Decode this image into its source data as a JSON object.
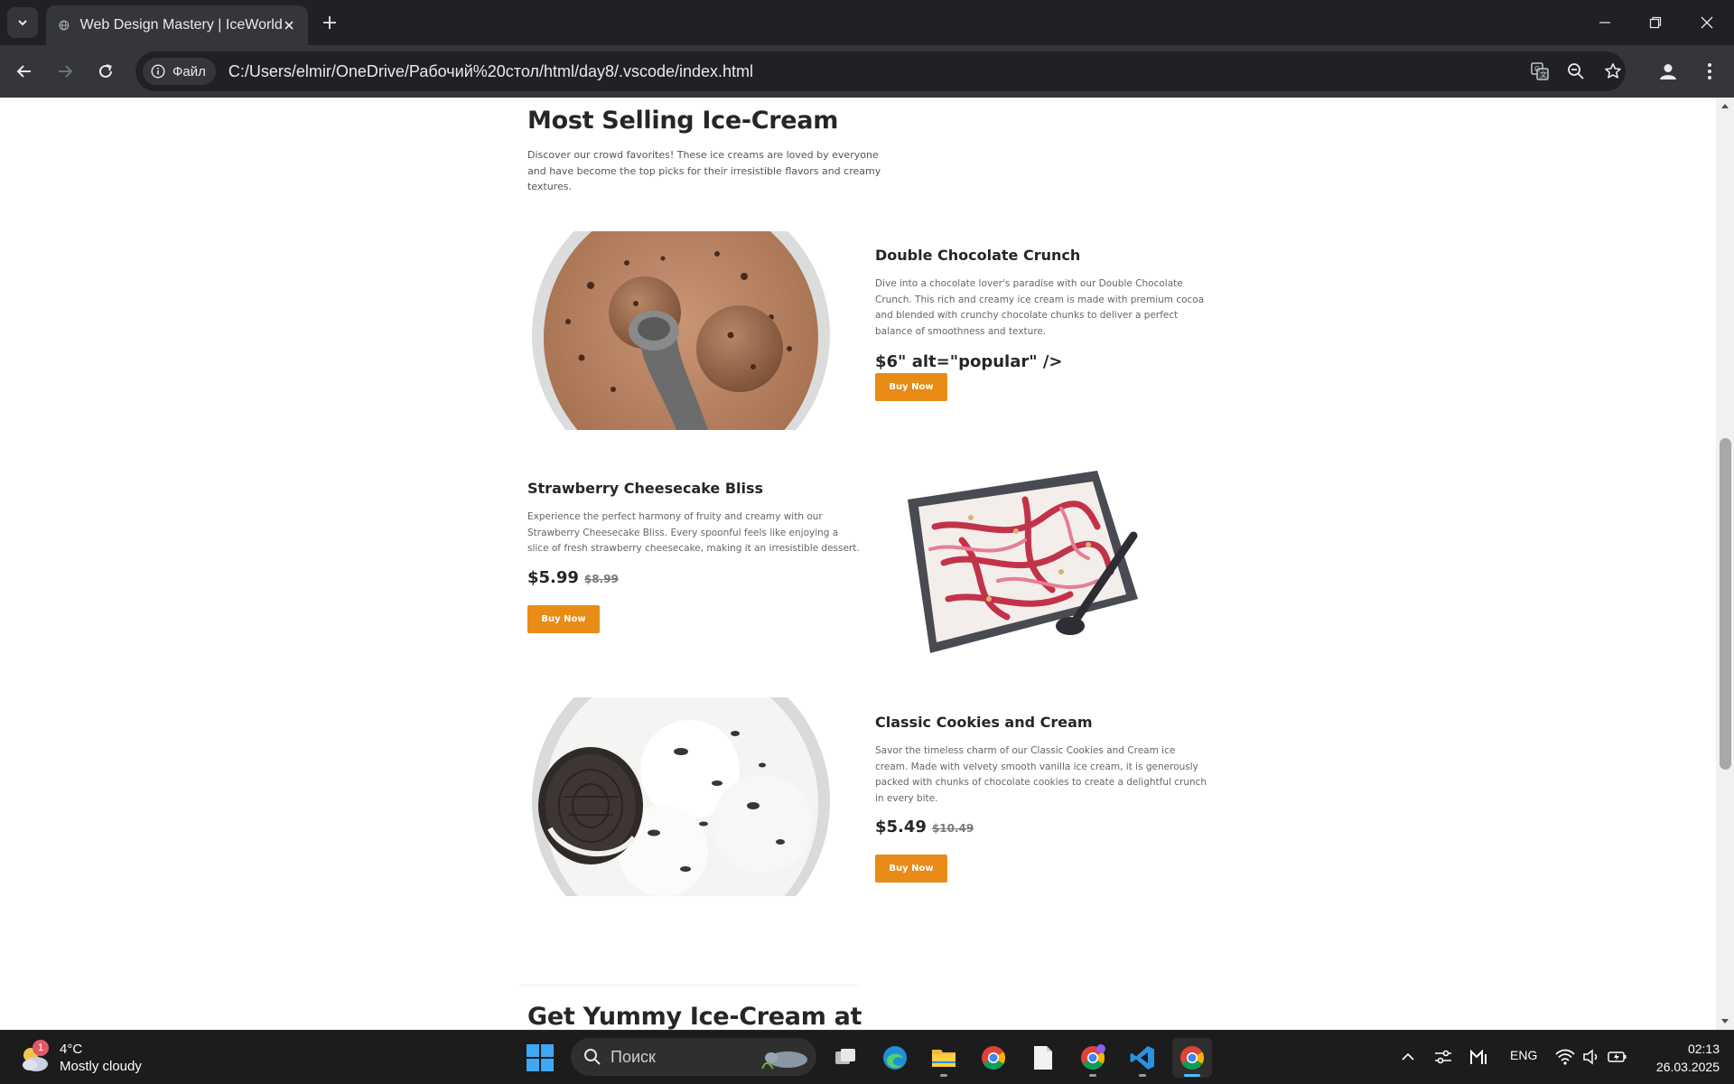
{
  "browser": {
    "tab_title": "Web Design Mastery | IceWorld",
    "security_chip": "Файл",
    "url": "C:/Users/elmir/OneDrive/Рабочий%20стол/html/day8/.vscode/index.html"
  },
  "page": {
    "section_title": "Most Selling Ice-Cream",
    "section_desc": "Discover our crowd favorites! These ice creams are loved by everyone and have become the top picks for their irresistible flavors and creamy textures.",
    "products": [
      {
        "name": "Double Chocolate Crunch",
        "desc": "Dive into a chocolate lover's paradise with our Double Chocolate Crunch. This rich and creamy ice cream is made with premium cocoa and blended with crunchy chocolate chunks to deliver a perfect balance of smoothness and texture.",
        "price": "$6\" alt=\"popular\" />",
        "old_price": "",
        "button": "Buy Now"
      },
      {
        "name": "Strawberry Cheesecake Bliss",
        "desc": "Experience the perfect harmony of fruity and creamy with our Strawberry Cheesecake Bliss. Every spoonful feels like enjoying a slice of fresh strawberry cheesecake, making it an irresistible dessert.",
        "price": "$5.99",
        "old_price": "$8.99",
        "button": "Buy Now"
      },
      {
        "name": "Classic Cookies and Cream",
        "desc": "Savor the timeless charm of our Classic Cookies and Cream ice cream. Made with velvety smooth vanilla ice cream, it is generously packed with chunks of chocolate cookies to create a delightful crunch in every bite.",
        "price": "$5.49",
        "old_price": "$10.49",
        "button": "Buy Now"
      }
    ],
    "next_section_title": "Get Yummy Ice-Cream at"
  },
  "taskbar": {
    "weather_temp": "4°C",
    "weather_condition": "Mostly cloudy",
    "weather_badge": "1",
    "search_placeholder": "Поиск",
    "language": "ENG",
    "time": "02:13",
    "date": "26.03.2025"
  },
  "colors": {
    "accent_button": "#e88b17",
    "chrome_dark": "#202124",
    "chrome_toolbar": "#35363a"
  }
}
